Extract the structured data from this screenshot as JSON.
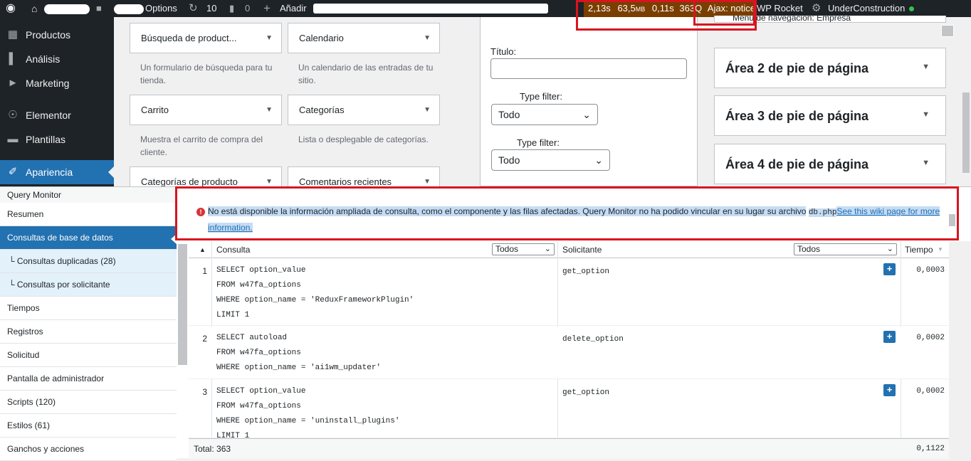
{
  "adminbar": {
    "site_label": "Options",
    "updates_count": "10",
    "comments_count": "0",
    "add_new": "Añadir",
    "qm_time": "2,13s",
    "qm_memory": "63,5",
    "qm_memory_unit": "MB",
    "qm_db_time": "0,11s",
    "qm_queries": "363Q",
    "ajax_notice": "Ajax: notice",
    "wp_rocket": "WP Rocket",
    "under_construction": "UnderConstruction",
    "status_color": "#31c44d"
  },
  "sidemenu": {
    "items": [
      {
        "label": "Productos",
        "icon": "box-icon"
      },
      {
        "label": "Análisis",
        "icon": "bar-chart-icon"
      },
      {
        "label": "Marketing",
        "icon": "megaphone-icon"
      },
      {
        "label": "Elementor",
        "icon": "elementor-icon"
      },
      {
        "label": "Plantillas",
        "icon": "folder-icon"
      },
      {
        "label": "Apariencia",
        "icon": "paintbrush-icon"
      }
    ],
    "active_color": "#2271b1"
  },
  "widgets": {
    "items": [
      {
        "title": "Búsqueda de product...",
        "desc": "Un formulario de búsqueda para tu tienda."
      },
      {
        "title": "Calendario",
        "desc": "Un calendario de las entradas de tu sitio."
      },
      {
        "title": "Carrito",
        "desc": "Muestra el carrito de compra del cliente."
      },
      {
        "title": "Categorías",
        "desc": "Lista o desplegable de categorías."
      },
      {
        "title": "Categorías de producto",
        "desc": ""
      },
      {
        "title": "Comentarios recientes",
        "desc": ""
      }
    ]
  },
  "form": {
    "title_label": "Título:",
    "filter1_label": "Type filter:",
    "filter1_value": "Todo",
    "filter2_label": "Type filter:",
    "filter2_value": "Todo"
  },
  "areas": {
    "partial_top": "Menú de navegación: Empresa",
    "items": [
      "Área 2 de pie de página",
      "Área 3 de pie de página",
      "Área 4 de pie de página"
    ]
  },
  "qm": {
    "title": "Query Monitor",
    "nav": [
      {
        "label": "Resumen",
        "type": "normal"
      },
      {
        "label": "Consultas de base de datos",
        "type": "selected"
      },
      {
        "label": "└ Consultas duplicadas (28)",
        "type": "sub"
      },
      {
        "label": "└ Consultas por solicitante",
        "type": "sub"
      },
      {
        "label": "Tiempos",
        "type": "normal"
      },
      {
        "label": "Registros",
        "type": "normal"
      },
      {
        "label": "Solicitud",
        "type": "normal"
      },
      {
        "label": "Pantalla de administrador",
        "type": "normal"
      },
      {
        "label": "Scripts (120)",
        "type": "normal"
      },
      {
        "label": "Estilos (61)",
        "type": "normal"
      },
      {
        "label": "Ganchos y acciones",
        "type": "normal"
      }
    ],
    "notice_text": "No está disponible la información ampliada de consulta, como el componente y las filas afectadas. Query Monitor no ha podido vincular en su lugar su archivo",
    "notice_file": "db.php",
    "notice_link": "See this wiki page for more information.",
    "headers": {
      "query": "Consulta",
      "query_filter": "Todos",
      "caller": "Solicitante",
      "caller_filter": "Todos",
      "time": "Tiempo"
    },
    "rows": [
      {
        "num": "1",
        "sql": [
          "SELECT option_value",
          "FROM w47fa_options",
          "WHERE option_name = 'ReduxFrameworkPlugin'",
          "LIMIT 1"
        ],
        "caller": "get_option",
        "time": "0,0003"
      },
      {
        "num": "2",
        "sql": [
          "SELECT autoload",
          "FROM w47fa_options",
          "WHERE option_name = 'ai1wm_updater'"
        ],
        "caller": "delete_option",
        "time": "0,0002"
      },
      {
        "num": "3",
        "sql": [
          "SELECT option_value",
          "FROM w47fa_options",
          "WHERE option_name = 'uninstall_plugins'",
          "LIMIT 1"
        ],
        "caller": "get_option",
        "time": "0,0002"
      }
    ],
    "total_label": "Total: 363",
    "total_time": "0,1122",
    "notice_bg": "#c5dcf5",
    "error_color": "#d63638"
  }
}
